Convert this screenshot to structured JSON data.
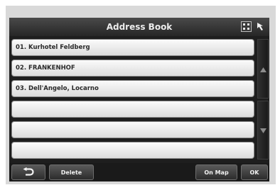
{
  "window": {
    "title": "Address Book",
    "icons": [
      "grid-menu-icon",
      "pointer-arrow-icon"
    ]
  },
  "address_list": {
    "items": [
      {
        "label": "01.  Kurhotel Feldberg"
      },
      {
        "label": "02.  FRANKENHOF"
      },
      {
        "label": "03.  Dell'Angelo, Locarno"
      },
      {
        "label": ""
      },
      {
        "label": ""
      },
      {
        "label": ""
      }
    ]
  },
  "scrollbar": {
    "up_icon": "scroll-up-arrow-icon",
    "down_icon": "scroll-down-arrow-icon"
  },
  "toolbar": {
    "back_icon": "back-arrow-icon",
    "delete_label": "Delete",
    "on_map_label": "On Map",
    "ok_label": "OK"
  }
}
